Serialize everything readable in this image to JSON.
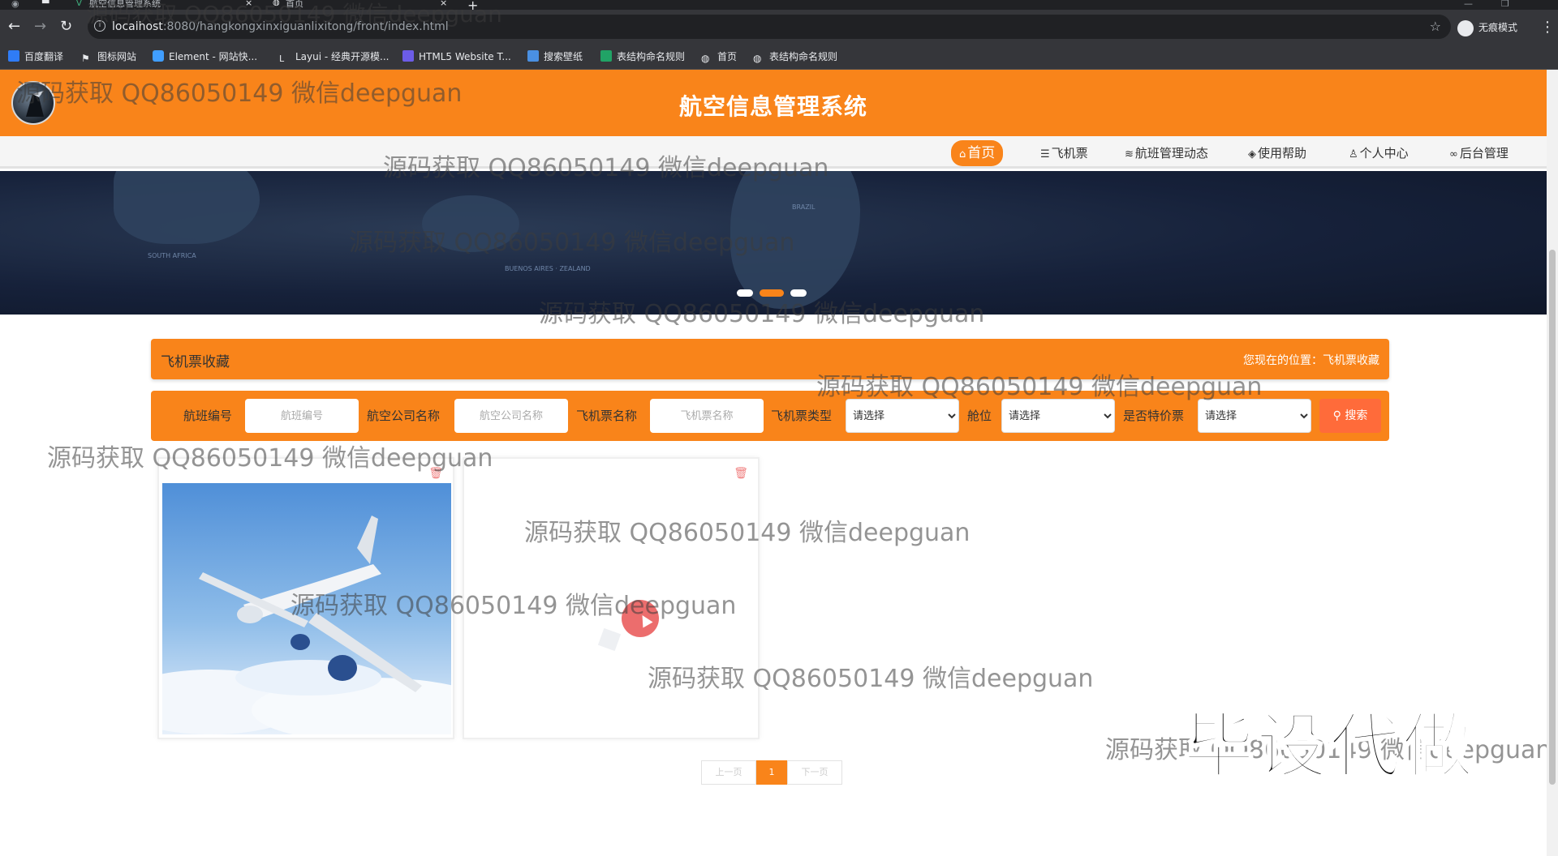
{
  "browser": {
    "tabs": [
      {
        "label": "航空信息管理系统",
        "active": false
      },
      {
        "label": "首页",
        "active": true
      }
    ],
    "new_tab": "+",
    "url_host": "localhost",
    "url_rest": ":8080/hangkongxinxiguanlixitong/front/index.html",
    "profile_label": "无痕模式",
    "bookmarks": [
      {
        "label": "百度翻译",
        "icon": "baidu-translate-icon",
        "color": "#2f7cf6"
      },
      {
        "label": "图标网站",
        "icon": "flag-icon",
        "color": "#e8eaed"
      },
      {
        "label": "Element - 网站快...",
        "icon": "element-icon",
        "color": "#409eff"
      },
      {
        "label": "Layui - 经典开源模...",
        "icon": "layui-icon",
        "color": "#e8eaed"
      },
      {
        "label": "HTML5 Website T...",
        "icon": "html5-icon",
        "color": "#6c5ce7"
      },
      {
        "label": "搜索壁纸",
        "icon": "wallpaper-icon",
        "color": "#4a90e2"
      },
      {
        "label": "表结构命名规则",
        "icon": "sheet-icon",
        "color": "#21a366"
      },
      {
        "label": "首页",
        "icon": "globe-icon",
        "color": "#e8eaed"
      },
      {
        "label": "表结构命名规则",
        "icon": "globe-icon",
        "color": "#e8eaed"
      }
    ]
  },
  "site": {
    "title": "航空信息管理系统",
    "nav": [
      {
        "label": "首页",
        "icon": "home-icon",
        "active": true
      },
      {
        "label": "飞机票",
        "icon": "sliders-icon",
        "active": false
      },
      {
        "label": "航班管理动态",
        "icon": "layers-icon",
        "active": false
      },
      {
        "label": "使用帮助",
        "icon": "shield-icon",
        "active": false
      },
      {
        "label": "个人中心",
        "icon": "user-icon",
        "active": false
      },
      {
        "label": "后台管理",
        "icon": "link-icon",
        "active": false
      }
    ],
    "banner": {
      "cities": [
        "SOUTH AFRICA",
        "BUENOS AIRES · ZEALAND",
        "BRAZIL"
      ],
      "slide_count": 3,
      "active_slide": 2
    }
  },
  "collection": {
    "title": "飞机票收藏",
    "location": "您现在的位置：飞机票收藏"
  },
  "search": {
    "fields": [
      {
        "label": "航班编号",
        "placeholder": "航班编号"
      },
      {
        "label": "航空公司名称",
        "placeholder": "航空公司名称"
      },
      {
        "label": "飞机票名称",
        "placeholder": "飞机票名称"
      }
    ],
    "selects": [
      {
        "label": "飞机票类型",
        "value": "请选择"
      },
      {
        "label": "舱位",
        "value": "请选择"
      },
      {
        "label": "是否特价票",
        "value": "请选择"
      }
    ],
    "button": "搜索"
  },
  "cards": [
    {
      "image": "airplane-photo",
      "has_image": true
    },
    {
      "image": "",
      "has_image": false
    }
  ],
  "pagination": {
    "prev": "上一页",
    "current": "1",
    "next": "下一页"
  },
  "overlay": {
    "watermark": "源码获取 QQ86050149 微信deepguan",
    "stamp": "毕设代做"
  },
  "colors": {
    "brand": "#f9841a",
    "search_button": "#ff6b3a"
  }
}
